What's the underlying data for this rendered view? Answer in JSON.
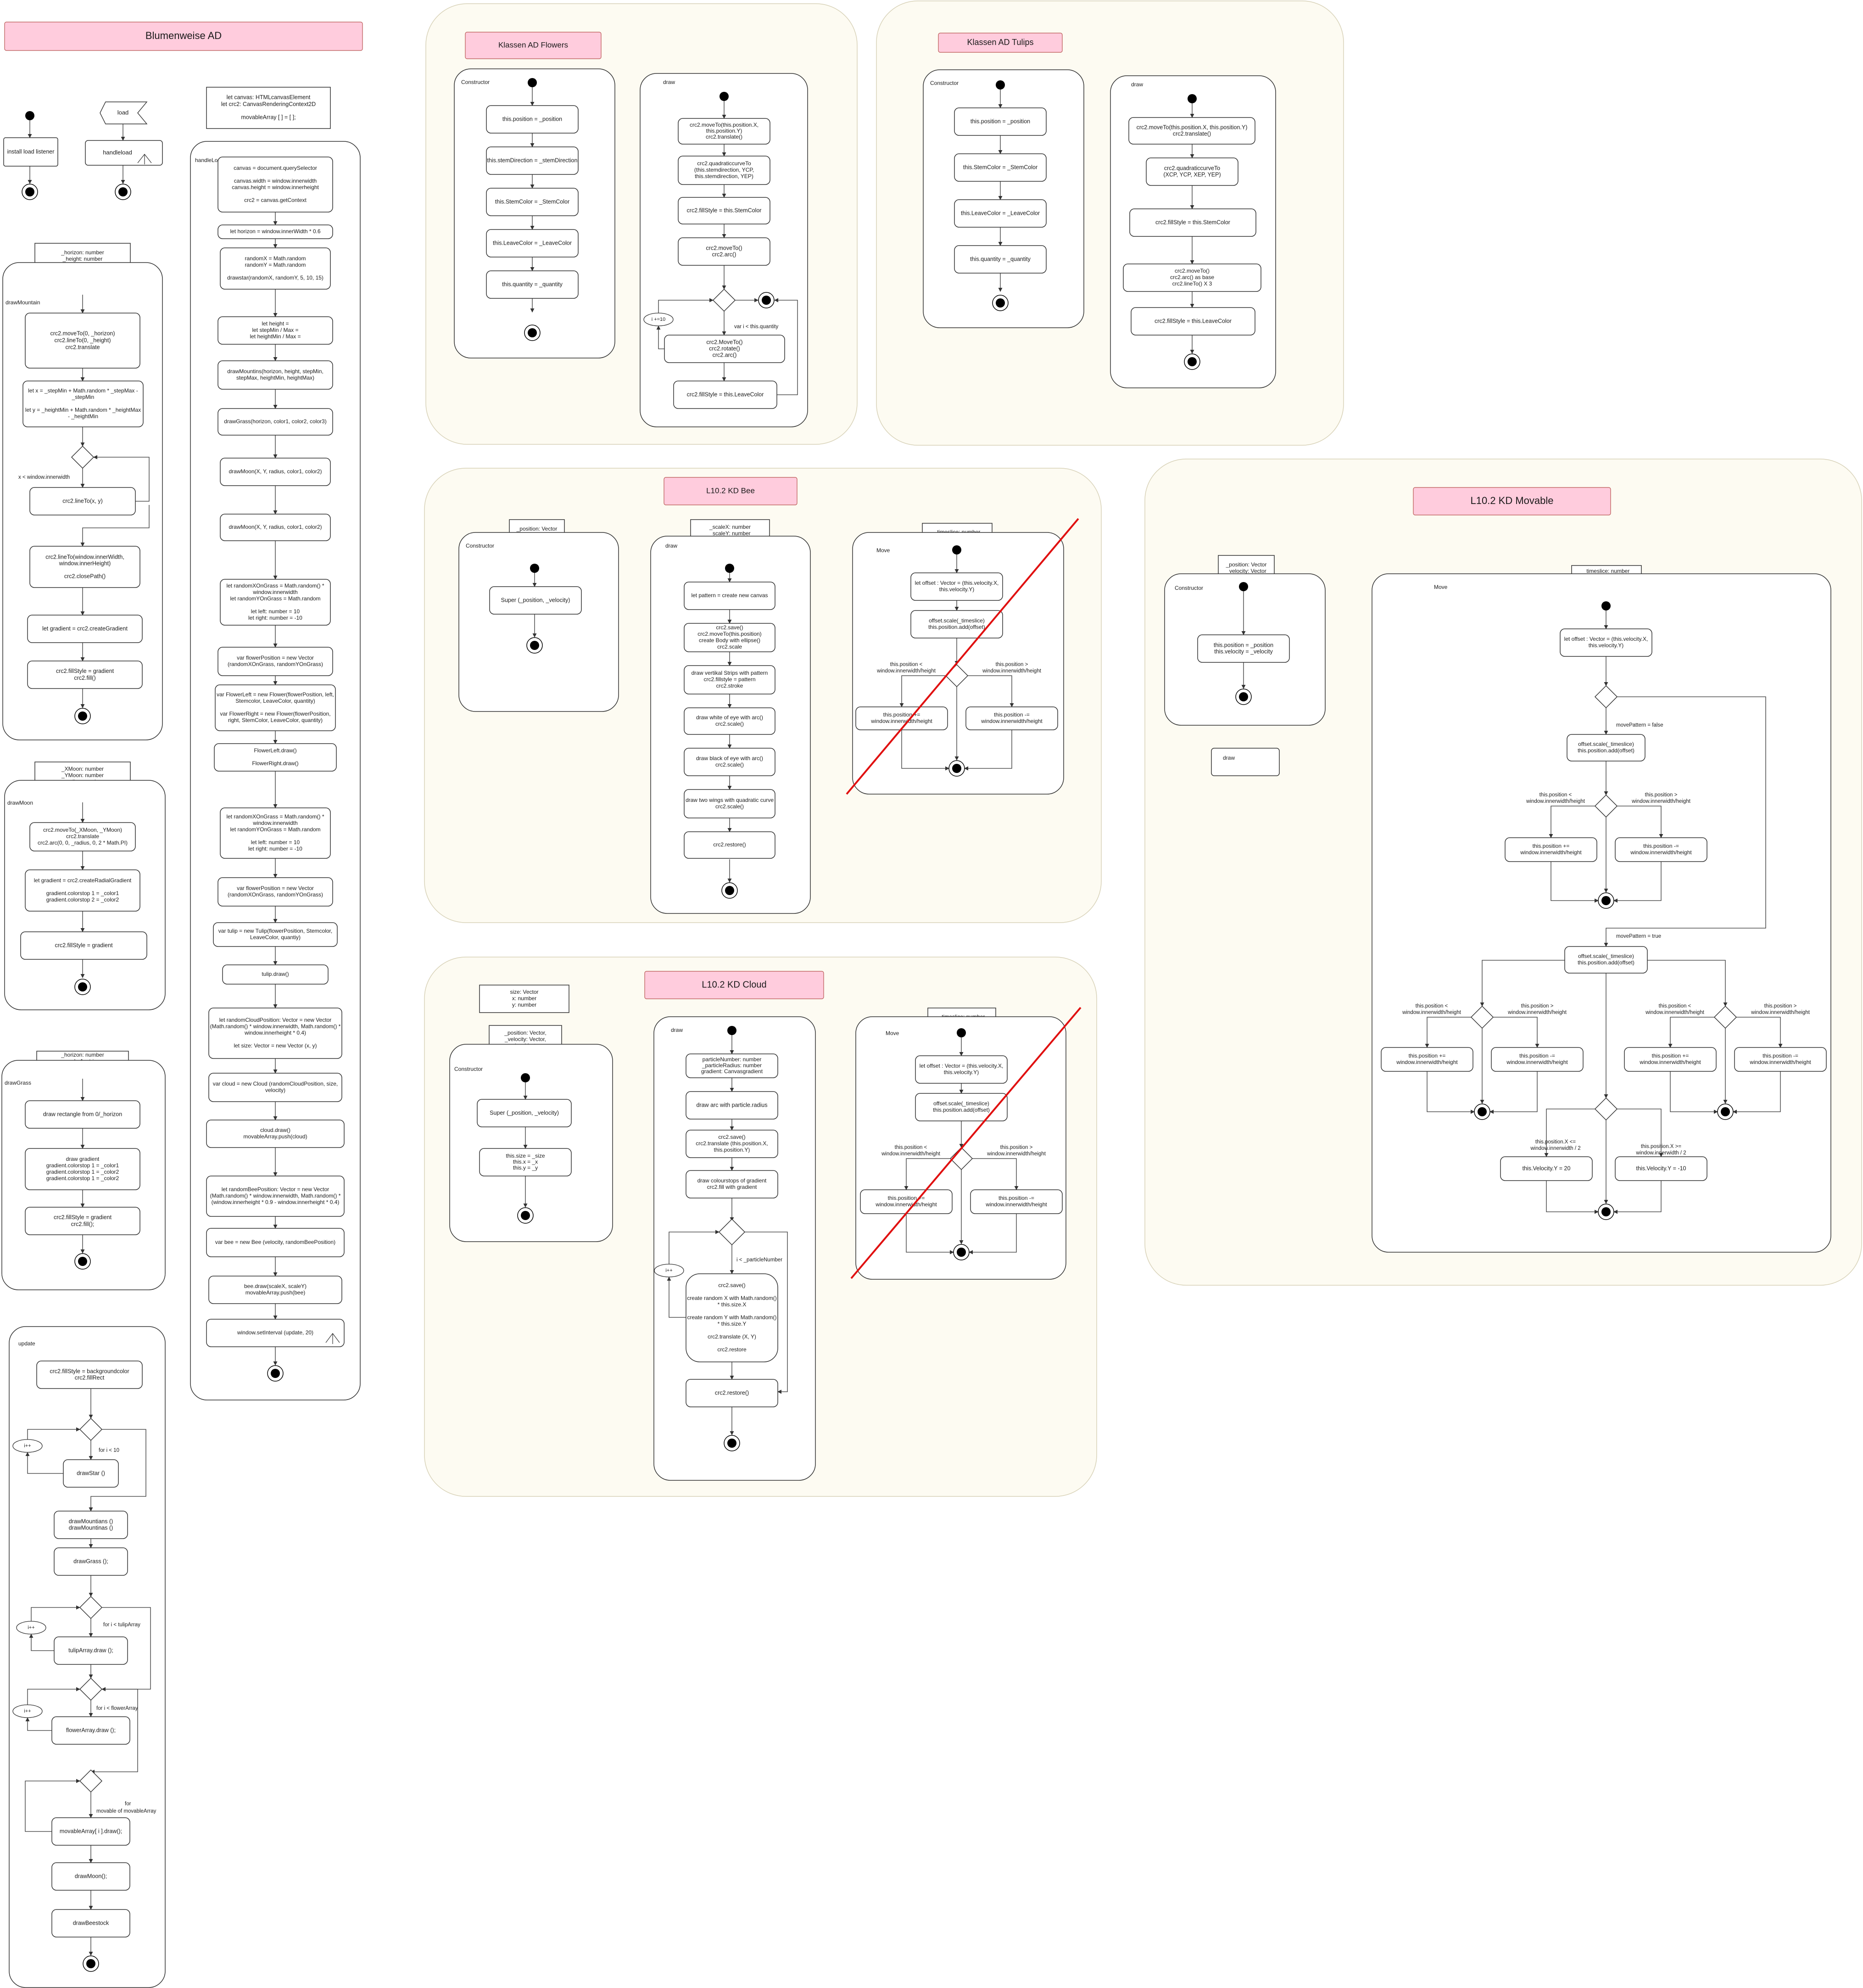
{
  "colors": {
    "title_fill": "#ffccdd",
    "title_stroke": "#b85450",
    "panel_fill": "#fdfbf2",
    "panel_stroke": "#d8d2b8",
    "node_stroke": "#333333",
    "accent_pink": "#e0007a",
    "strike_red": "#e01010"
  },
  "titles": {
    "main": "Blumenweise AD",
    "flowers": "Klassen AD Flowers",
    "tulips": "Klassen AD Tulips",
    "bee": "L10.2 KD Bee",
    "movable": "L10.2 KD Movable",
    "cloud": "L10.2 KD Cloud"
  },
  "left": {
    "install_listener": "install load listener",
    "load_event": "load",
    "handleload_action": "handleload",
    "globals": [
      "let canvas: HTMLcanvasElement",
      "let crc2: CanvasRenderingContext2D"
    ],
    "movable_array": "movableArray [ ] = [ ];",
    "mountain_params": [
      "_horizon: number",
      "_height: number",
      "_stepMin: number",
      "_stepMax: number",
      "_heightMin: number",
      "_heightMax: number"
    ],
    "mountain_label": "drawMountain",
    "mountain_nodes": [
      [
        "crc2.moveTo(0, _horizon)",
        "crc2.lineTo(0, _height)",
        "crc2.translate"
      ],
      [
        "let x = _stepMin + Math.random * _stepMax -",
        "_stepMin",
        "",
        "let y = _heightMin + Math.random * _heightMax",
        "- _heightMin"
      ],
      [
        "crc2.lineTo(x, y)"
      ],
      [
        "crc2.lineTo(window.innerWidth,",
        "window.innerHeight)",
        "",
        "crc2.closePath()"
      ],
      [
        "let gradient = crc2.createGradient"
      ],
      [
        "crc2.fillStyle = gradient",
        "crc2.fill()"
      ]
    ],
    "mountain_guard": "x <  window.innerwidth",
    "moon_params": [
      "_XMoon: number",
      "_YMoon: number",
      "_radius: number",
      "_color1: string",
      "_color2: string"
    ],
    "moon_label": "drawMoon",
    "moon_nodes": [
      [
        "crc2.moveTo(_XMoon, _YMoon)",
        "crc2.translate",
        "crc2.arc(0, 0, _radius, 0, 2 * Math.PI)"
      ],
      [
        "let gradient = crc2.createRadialGradient",
        "",
        "gradient.colorstop 1 = _color1",
        "gradient.colorstop 2 = _color2"
      ],
      [
        "crc2.fillStyle = gradient"
      ]
    ],
    "grass_params": [
      "_horizon: number",
      "_color1: string",
      "_color2: string",
      "_color3: string"
    ],
    "grass_label": "drawGrass",
    "grass_nodes": [
      [
        "draw rectangle from 0/_horizon"
      ],
      [
        "draw gradient",
        "gradient.colorstop 1 = _color1",
        "gradient.colorstop 1 = _color2",
        "gradient.colorstop 1 = _color2"
      ],
      [
        "crc2.fillStyle = gradient",
        "crc2.fill();"
      ]
    ],
    "update_label": "update",
    "update_nodes": [
      [
        "crc2.fillStyle = backgroundcolor",
        "crc2.fillRect"
      ],
      [
        "drawStar ()"
      ],
      [
        "drawMountians ()",
        "drawMountinas ()"
      ],
      [
        "drawGrass ();"
      ],
      [
        "tulipArray.draw ();"
      ],
      [
        "flowerArray.draw ();"
      ],
      [
        "movableArray[ i ].draw();"
      ],
      [
        "drawMoon();"
      ],
      [
        "drawBeestock"
      ]
    ],
    "update_guards": [
      "for i < 10",
      "for i < tulipArray",
      "for i < flowerArray",
      "for",
      "movable of movableArray"
    ],
    "increment": "i++"
  },
  "handleload": {
    "label": "handleLoad",
    "nodes": [
      [
        "canvas = document.querySelector",
        "",
        "canvas.width = window.innerwidth",
        "canvas.height = window.innerheight",
        "",
        "crc2 = canvas.getContext"
      ],
      [
        "let horizon = window.innerWidth * 0.6"
      ],
      [
        "randomX = Math.random",
        "randomY = Math.random",
        "",
        "drawstar(randomX, randomY, 5, 10, 15)"
      ],
      [
        "let height =",
        "let stepMin / Max =",
        "let heightMin / Max ="
      ],
      [
        "drawMountins(horizon, height, stepMin,",
        "stepMax, heightMin, heightMax)"
      ],
      [
        "drawGrass(horizon, color1, color2, color3)"
      ],
      [
        "drawMoon(X, Y, radius, color1, color2)"
      ],
      [
        "drawMoon(X, Y, radius, color1, color2)"
      ],
      [
        "let randomXOnGrass = Math.random() *",
        "window.innerwidth",
        "let randomYOnGrass = Math.random",
        "",
        "let left: number = 10",
        "let right: number = -10"
      ],
      [
        "var flowerPosition = new Vector",
        "(randomXOnGrass, randomYOnGrass)"
      ],
      [
        "var FlowerLeft = new Flower(flowerPosition, left,",
        "Stemcolor, LeaveColor, quantity)",
        "",
        "var FlowerRight = new Flower(flowerPosition,",
        "right, StemColor, LeaveColor, quantity)"
      ],
      [
        "FlowerLeft.draw()",
        "",
        "FlowerRight.draw()"
      ],
      [
        "let randomXOnGrass = Math.random() *",
        "window.innerwidth",
        "let randomYOnGrass = Math.random",
        "",
        "let left: number = 10",
        "let right: number = -10"
      ],
      [
        "var flowerPosition = new Vector",
        "(randomXOnGrass, randomYOnGrass)"
      ],
      [
        "var tulip = new Tulip(flowerPosition, Stemcolor,",
        "LeaveColor, quantiy)"
      ],
      [
        "tulip.draw()"
      ],
      [
        "let randomCloudPosition: Vector = new Vector",
        "(Math.random() * window.innerwidth, Math.random() *",
        "window.innerheight * 0.4)",
        "",
        "let size: Vector = new Vector (x, y)"
      ],
      [
        "var cloud = new Cloud (randomCloudPosition, size,",
        "velocity)"
      ],
      [
        "cloud.draw()",
        "movableArray.push(cloud)"
      ],
      [
        "let randomBeePosition: Vector = new Vector",
        "(Math.random() * window.innerwidth, Math.random() *",
        "(window.innerheight * 0.9 - window.innerheight * 0.4)"
      ],
      [
        "var bee = new Bee (velocity, randomBeePosition)"
      ],
      [
        "bee.draw(scaleX, scaleY)",
        "movableArray.push(bee)"
      ],
      [
        "window.setInterval (update, 20)"
      ]
    ]
  },
  "flowers": {
    "constructor_label": "Constructor",
    "draw_label": "draw",
    "constructor_nodes": [
      "this.position = _position",
      "this.stemDirection = _stemDirection",
      "this.StemColor = _StemColor",
      "this.LeaveColor = _LeaveColor",
      "this.quantity = _quantity"
    ],
    "draw_nodes": [
      [
        "crc2.moveTo(this.position.X,",
        "this.position.Y)",
        "crc2.translate()"
      ],
      [
        "crc2.quadraticcurveTo",
        "(this.stemdirection, YCP,",
        "this.stemdirection, YEP)"
      ],
      [
        "crc2.fillStyle = this.StemColor"
      ],
      [
        "crc2.moveTo()",
        "crc2.arc()"
      ],
      [
        "crc2.MoveTo()",
        "crc2.rotate()",
        "crc2.arc()"
      ],
      [
        "crc2.fillStyle = this.LeaveColor"
      ]
    ],
    "loop_guard": "var i < this.quantity",
    "increment": "i +=10"
  },
  "tulips": {
    "constructor_label": "Constructor",
    "draw_label": "draw",
    "constructor_nodes": [
      "this.position = _position",
      "this.StemColor = _StemColor",
      "this.LeaveColor = _LeaveColor",
      "this.quantity = _quantity"
    ],
    "draw_nodes": [
      [
        "crc2.moveTo(this.position.X, this.position.Y)",
        "crc2.translate()"
      ],
      [
        "crc2.quadraticcurveTo",
        "(XCP, YCP, XEP, YEP)"
      ],
      [
        "crc2.fillStyle = this.StemColor"
      ],
      [
        "crc2.moveTo()",
        "crc2.arc() as base",
        "crc2.lineTo() X 3"
      ],
      [
        "crc2.fillStyle = this.LeaveColor"
      ]
    ]
  },
  "bee": {
    "ctor_params": [
      "_position: Vector",
      "_velocity: Vector"
    ],
    "constructor_label": "Constructor",
    "super_call": "Super (_position, _velocity)",
    "draw_params": [
      "_scaleX: number",
      "_scaleY: number"
    ],
    "draw_label": "draw",
    "draw_nodes": [
      [
        "let pattern =  create new canvas"
      ],
      [
        "crc2.save()",
        "crc2.moveTo(this.position)",
        "create Body with ellipse()",
        "crc2.scale"
      ],
      [
        "draw vertikal Strips with pattern",
        "crc2.fillstyle = pattern",
        "crc2.stroke"
      ],
      [
        "draw white of eye with arc()",
        "crc2.scale()"
      ],
      [
        "draw black of eye with arc()",
        "crc2.scale()"
      ],
      [
        "draw two wings with quadratic curve",
        "crc2.scale()"
      ],
      [
        "crc2.restore()"
      ]
    ],
    "move_params": [
      "_timeslice: number"
    ],
    "move_label": "Move",
    "move_nodes": [
      [
        "let offset : Vector = (this.velocity.X,",
        "this.velocity.Y)"
      ],
      [
        "offset.scale(_timeslice)",
        "this.position.add(offset)"
      ],
      [
        "this.position +=",
        "window.innerwidth/height"
      ],
      [
        "this.position -=",
        "window.innerwidth/height"
      ]
    ],
    "move_guards": [
      [
        "this.position <",
        "window.innerwidth/height"
      ],
      [
        "this.position >",
        "window.innerwidth/height"
      ]
    ]
  },
  "cloud": {
    "class_attrs": [
      "size: Vector",
      "x: number",
      "y: number"
    ],
    "ctor_params": [
      "_position: Vector,",
      "_velocity: Vector,",
      "_size: Vector,",
      "_x: number",
      "_y: number"
    ],
    "constructor_label": "Constructor",
    "ctor_nodes": [
      [
        "Super (_position, _velocity)"
      ],
      [
        "this.size = _size",
        "this.x = _x",
        "this.y = _y"
      ]
    ],
    "draw_label": "draw",
    "draw_nodes": [
      [
        "particleNumber:  number",
        "_particleRadius: number",
        "gradient: Canvasgradient"
      ],
      [
        "draw arc with particle.radius"
      ],
      [
        "crc2.save()",
        "crc2.translate (this.position.X,",
        "this.position.Y)"
      ],
      [
        "draw  colourstops of gradient",
        "crc2.fill with gradient"
      ],
      [
        "crc2.save()",
        "",
        "create random X with Math.random()",
        "* this.size.X",
        "",
        "create random Y with Math.random()",
        "* this.size.Y",
        "",
        "crc2.translate (X, Y)",
        "",
        "crc2.restore"
      ],
      [
        "crc2.restore()"
      ]
    ],
    "loop_guard": "i < _particleNumber",
    "increment": "i++",
    "move_params": [
      "_timeslice: number"
    ],
    "move_label": "Move",
    "move_nodes": [
      [
        "let offset : Vector = (this.velocity.X,",
        "this.velocity.Y)"
      ],
      [
        "offset.scale(_timeslice)",
        "this.position.add(offset)"
      ],
      [
        "this.position +=",
        "window.innerwidth/height"
      ],
      [
        "this.position -=",
        "window.innerwidth/height"
      ]
    ],
    "move_guards": [
      [
        "this.position <",
        "window.innerwidth/height"
      ],
      [
        "this.position >",
        "window.innerwidth/height"
      ]
    ]
  },
  "tulips_unused": "",
  "movable": {
    "ctor_params": [
      "_position: Vector",
      "_velocity: Vector"
    ],
    "constructor_label": "Constructor",
    "ctor_node": [
      "this.position = _position",
      "this.velocity = _velocity"
    ],
    "draw_label": "draw",
    "move_params": [
      "_timeslice: number",
      "_movePattern: boolean"
    ],
    "move_label": "Move",
    "offset_node": [
      "let offset : Vector = (this.velocity.X,",
      "this.velocity.Y)"
    ],
    "pattern_false": "movePattern  = false",
    "pattern_true": "movePattern  = true",
    "scale_node": [
      "offset.scale(_timeslice)",
      "this.position.add(offset)"
    ],
    "plus_node": [
      "this.position +=",
      "window.innerwidth/height"
    ],
    "minus_node": [
      "this.position -=",
      "window.innerwidth/height"
    ],
    "guard_lt": [
      "this.position <",
      "window.innerwidth/height"
    ],
    "guard_gt": [
      "this.position >",
      "window.innerwidth/height"
    ],
    "guard_x_lo": [
      "this.position.X  <=",
      "window.innerwidth / 2"
    ],
    "guard_x_hi": [
      "this.position.X  >=",
      "window.innerwidth / 2"
    ],
    "vel_pos": "this.Velocity.Y = 20",
    "vel_neg": "this.Velocity.Y = -10"
  }
}
